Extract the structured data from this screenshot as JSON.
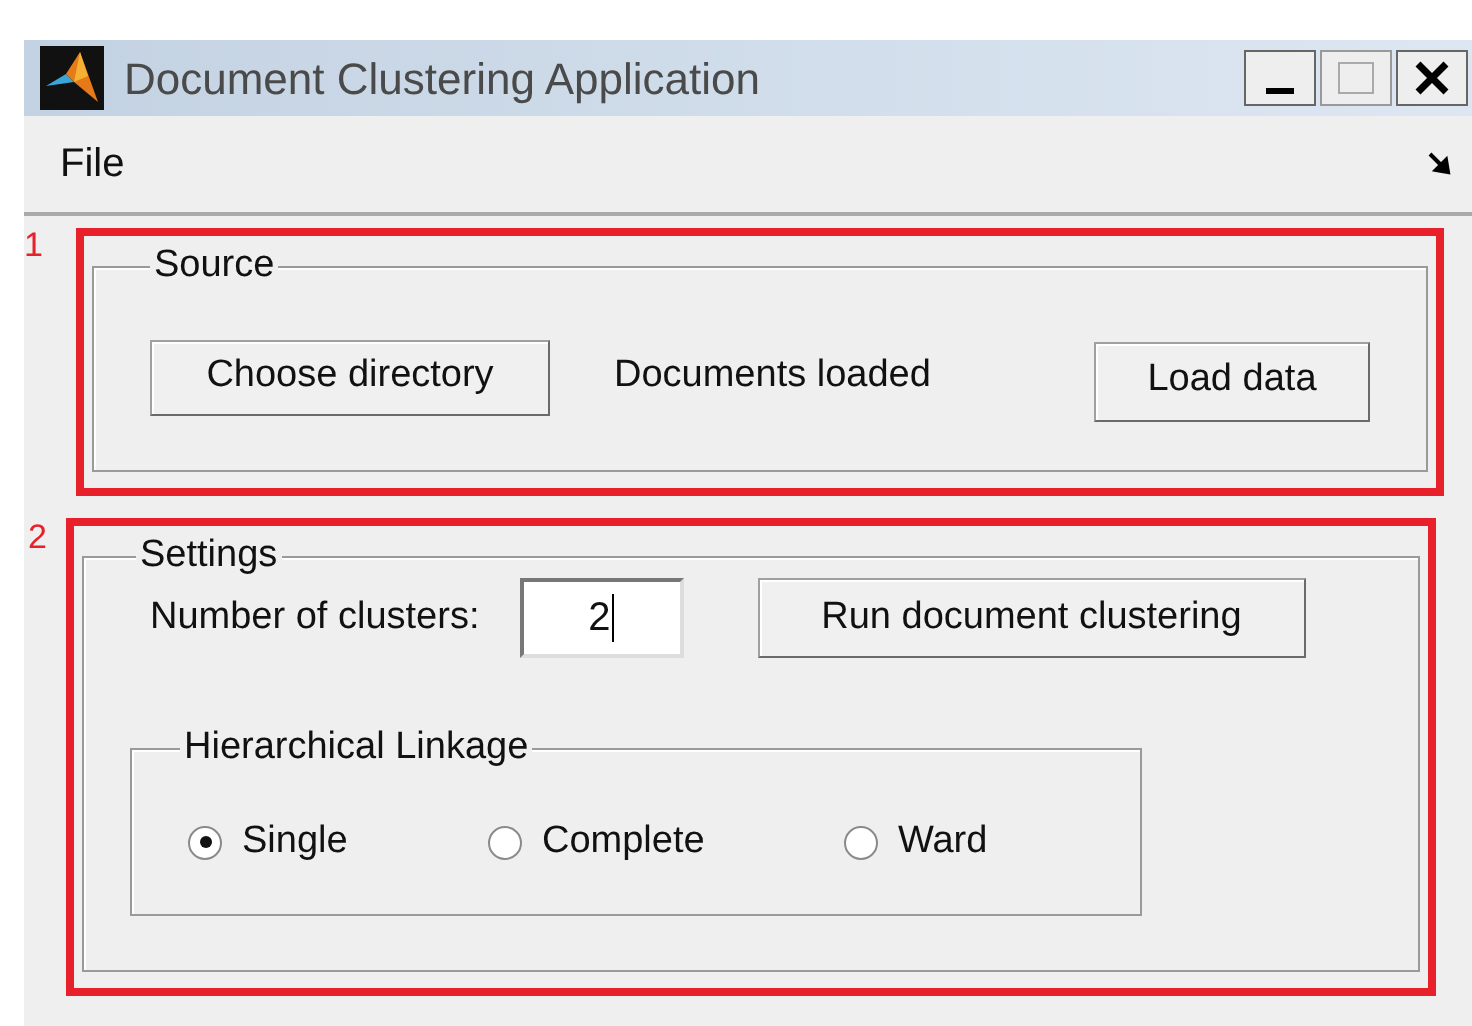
{
  "window": {
    "title": "Document Clustering Application"
  },
  "menu": [
    {
      "label": "File"
    }
  ],
  "source": {
    "marker": "1",
    "title": "Source",
    "choose_button": "Choose directory",
    "status": "Documents loaded",
    "load_button": "Load data"
  },
  "settings": {
    "marker": "2",
    "title": "Settings",
    "clusters_label": "Number of clusters:",
    "clusters_value": "2",
    "run_button": "Run document clustering",
    "linkage": {
      "title": "Hierarchical Linkage",
      "options": [
        {
          "label": "Single",
          "selected": true
        },
        {
          "label": "Complete",
          "selected": false
        },
        {
          "label": "Ward",
          "selected": false
        }
      ]
    }
  }
}
